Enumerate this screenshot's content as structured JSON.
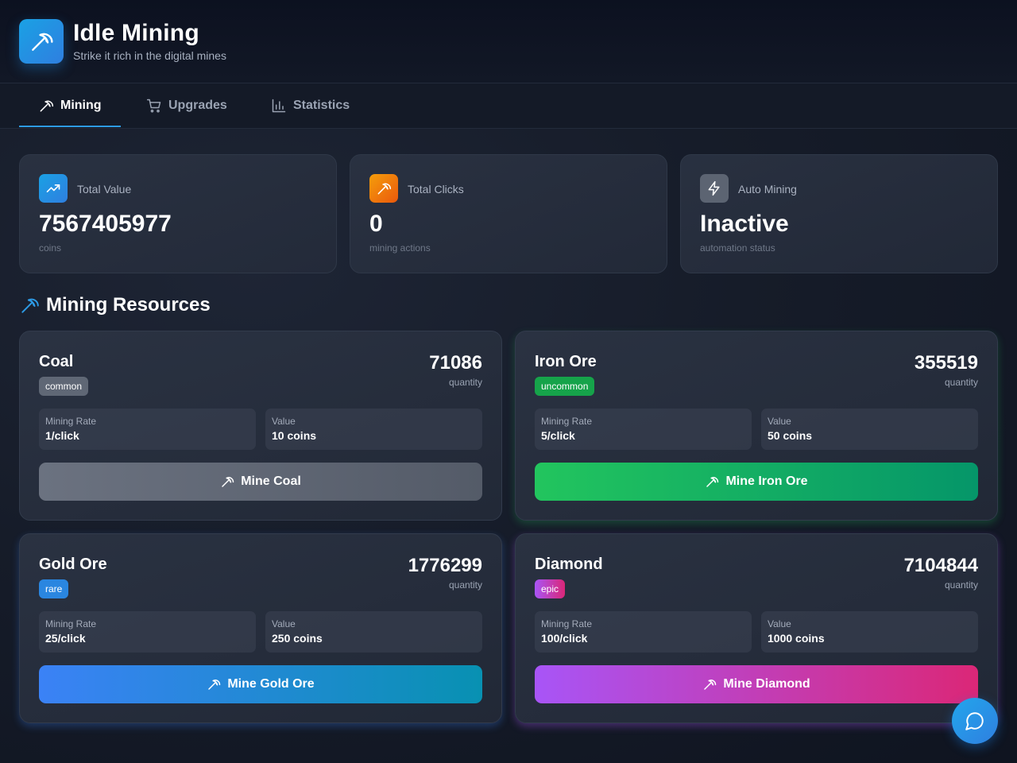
{
  "app": {
    "title": "Idle Mining",
    "subtitle": "Strike it rich in the digital mines",
    "logo_icon": "pickaxe-icon"
  },
  "tabs": [
    {
      "label": "Mining",
      "icon": "pickaxe-icon",
      "active": true
    },
    {
      "label": "Upgrades",
      "icon": "cart-icon",
      "active": false
    },
    {
      "label": "Statistics",
      "icon": "bar-chart-icon",
      "active": false
    }
  ],
  "stats": [
    {
      "label": "Total Value",
      "value": "7567405977",
      "sub": "coins",
      "icon": "trending-up-icon",
      "color": "#1e9be8"
    },
    {
      "label": "Total Clicks",
      "value": "0",
      "sub": "mining actions",
      "icon": "pickaxe-icon",
      "color": "#f07f18"
    },
    {
      "label": "Auto Mining",
      "value": "Inactive",
      "sub": "automation status",
      "icon": "lightning-icon",
      "color": "#5c6472"
    }
  ],
  "section": {
    "title": "Mining Resources",
    "icon": "pickaxe-icon"
  },
  "resources": [
    {
      "name": "Coal",
      "rarity": "common",
      "quantity": "71086",
      "quantity_label": "quantity",
      "rate_label": "Mining Rate",
      "rate": "1/click",
      "value_label": "Value",
      "value": "10 coins",
      "button_label": "Mine Coal",
      "badge_color": "#5f6775",
      "button_gradient": [
        "#6b7280",
        "#545b68"
      ]
    },
    {
      "name": "Iron Ore",
      "rarity": "uncommon",
      "quantity": "355519",
      "quantity_label": "quantity",
      "rate_label": "Mining Rate",
      "rate": "5/click",
      "value_label": "Value",
      "value": "50 coins",
      "button_label": "Mine Iron Ore",
      "badge_color": "#16a34a",
      "button_gradient": [
        "#22c55e",
        "#059669"
      ]
    },
    {
      "name": "Gold Ore",
      "rarity": "rare",
      "quantity": "1776299",
      "quantity_label": "quantity",
      "rate_label": "Mining Rate",
      "rate": "25/click",
      "value_label": "Value",
      "value": "250 coins",
      "button_label": "Mine Gold Ore",
      "badge_color": "#2a86e0",
      "button_gradient": [
        "#3b82f6",
        "#0891b2"
      ]
    },
    {
      "name": "Diamond",
      "rarity": "epic",
      "quantity": "7104844",
      "quantity_label": "quantity",
      "rate_label": "Mining Rate",
      "rate": "100/click",
      "value_label": "Value",
      "value": "1000 coins",
      "button_label": "Mine Diamond",
      "badge_color": "#c23bd4",
      "button_gradient": [
        "#a855f7",
        "#db2777"
      ]
    }
  ],
  "chat": {
    "icon": "chat-bubble-icon"
  }
}
